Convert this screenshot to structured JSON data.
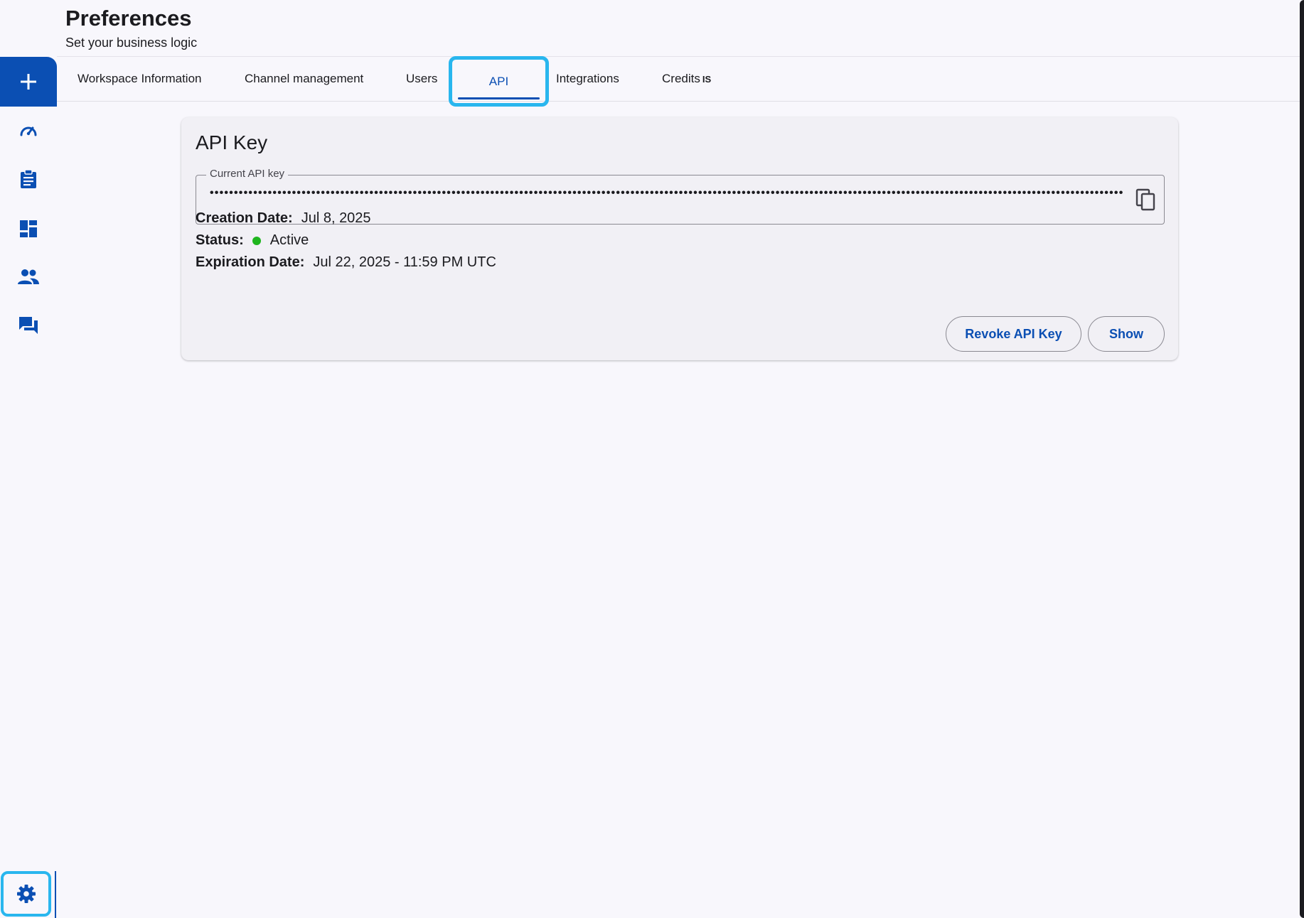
{
  "header": {
    "title": "Preferences",
    "subtitle": "Set your business logic"
  },
  "sidebar": {
    "add_icon": "plus-icon",
    "items": [
      {
        "icon": "speedometer-icon"
      },
      {
        "icon": "clipboard-icon"
      },
      {
        "icon": "dashboard-icon"
      },
      {
        "icon": "people-icon"
      },
      {
        "icon": "chat-icon"
      }
    ],
    "settings_icon": "gear-icon"
  },
  "tabs": {
    "items": [
      {
        "label": "Workspace Information"
      },
      {
        "label": "Channel management"
      },
      {
        "label": "Users"
      },
      {
        "label": "API",
        "selected": true
      },
      {
        "label": "Integrations"
      },
      {
        "label": "Credits"
      }
    ],
    "credits_suffix": "IS"
  },
  "api_card": {
    "title": "API Key",
    "field_label": "Current API key",
    "field_value": "••••••••••••••••••••••••••••••••••••••••••••••••••••••••••••••••••••••••••••••••••••••••••••••••••••••••••••••••••••••••••••••••••••••••••••••••••••••••••••••••••••••••••••••••••••••••••••••••••••••••••••••",
    "copy_icon": "copy-icon",
    "creation_label": "Creation Date:",
    "creation_value": "Jul 8, 2025",
    "status_label": "Status:",
    "status_value": "Active",
    "status_color": "#1fb51f",
    "expiration_label": "Expiration Date:",
    "expiration_value": "Jul 22, 2025 - 11:59 PM UTC",
    "revoke_button": "Revoke API Key",
    "show_button": "Show"
  },
  "colors": {
    "accent": "#0b4fb3",
    "highlight": "#29b6ee",
    "background": "#f8f7fc"
  }
}
